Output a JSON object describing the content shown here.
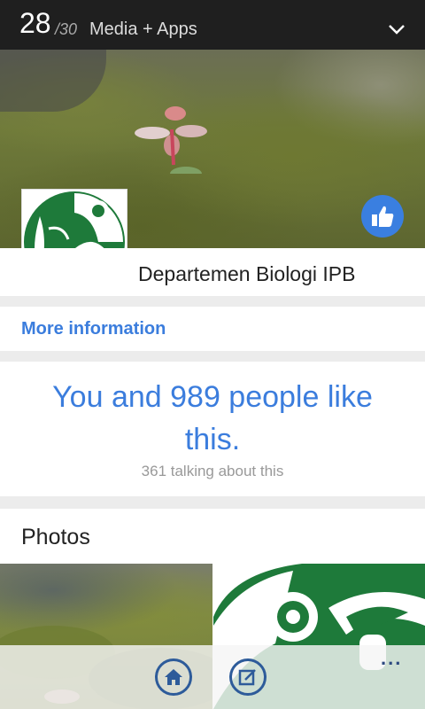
{
  "header": {
    "count": "28",
    "total": "/30",
    "section": "Media + Apps"
  },
  "page": {
    "name": "Departemen Biologi IPB"
  },
  "more_info": {
    "label": "More information"
  },
  "likes": {
    "line1": "You and 989 people like",
    "line2": "this.",
    "talking": "361 talking about this"
  },
  "photos": {
    "title": "Photos"
  },
  "appbar": {
    "more": "..."
  },
  "colors": {
    "accent": "#3b7ddd",
    "header_bg": "#1f1f1f",
    "logo_green": "#1e7a3a"
  }
}
